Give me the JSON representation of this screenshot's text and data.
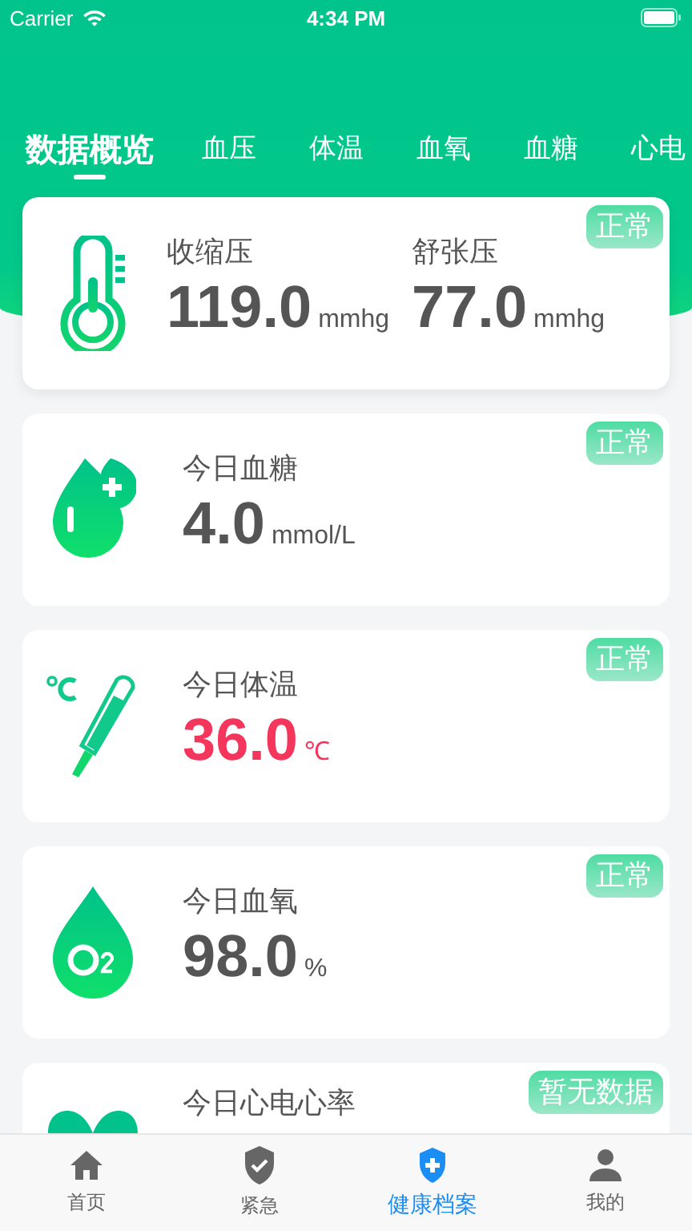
{
  "status_bar": {
    "carrier": "Carrier",
    "time": "4:34 PM"
  },
  "tabs": [
    {
      "label": "数据概览",
      "selected": true
    },
    {
      "label": "血压",
      "selected": false
    },
    {
      "label": "体温",
      "selected": false
    },
    {
      "label": "血氧",
      "selected": false
    },
    {
      "label": "血糖",
      "selected": false
    },
    {
      "label": "心电",
      "selected": false
    }
  ],
  "cards": [
    {
      "kind": "blood-pressure",
      "badge": "正常",
      "readings": [
        {
          "label": "收缩压",
          "value": "119.0",
          "unit": "mmhg"
        },
        {
          "label": "舒张压",
          "value": "77.0",
          "unit": "mmhg"
        }
      ],
      "color": "#555555"
    },
    {
      "kind": "glucose",
      "badge": "正常",
      "readings": [
        {
          "label": "今日血糖",
          "value": "4.0",
          "unit": "mmol/L"
        }
      ],
      "color": "#555555"
    },
    {
      "kind": "temperature",
      "badge": "正常",
      "readings": [
        {
          "label": "今日体温",
          "value": "36.0",
          "unit": "℃"
        }
      ],
      "color": "#f5365c"
    },
    {
      "kind": "oxygen",
      "badge": "正常",
      "readings": [
        {
          "label": "今日血氧",
          "value": "98.0",
          "unit": "%"
        }
      ],
      "color": "#555555"
    },
    {
      "kind": "ecg",
      "badge": "暂无数据",
      "readings": [
        {
          "label": "今日心电心率"
        }
      ]
    }
  ],
  "tab_bar": [
    {
      "kind": "home",
      "label": "首页",
      "selected": false
    },
    {
      "kind": "shield-check",
      "label": "紧急",
      "selected": false
    },
    {
      "kind": "shield-plus",
      "label": "健康档案",
      "selected": true
    },
    {
      "kind": "person",
      "label": "我的",
      "selected": false
    }
  ]
}
